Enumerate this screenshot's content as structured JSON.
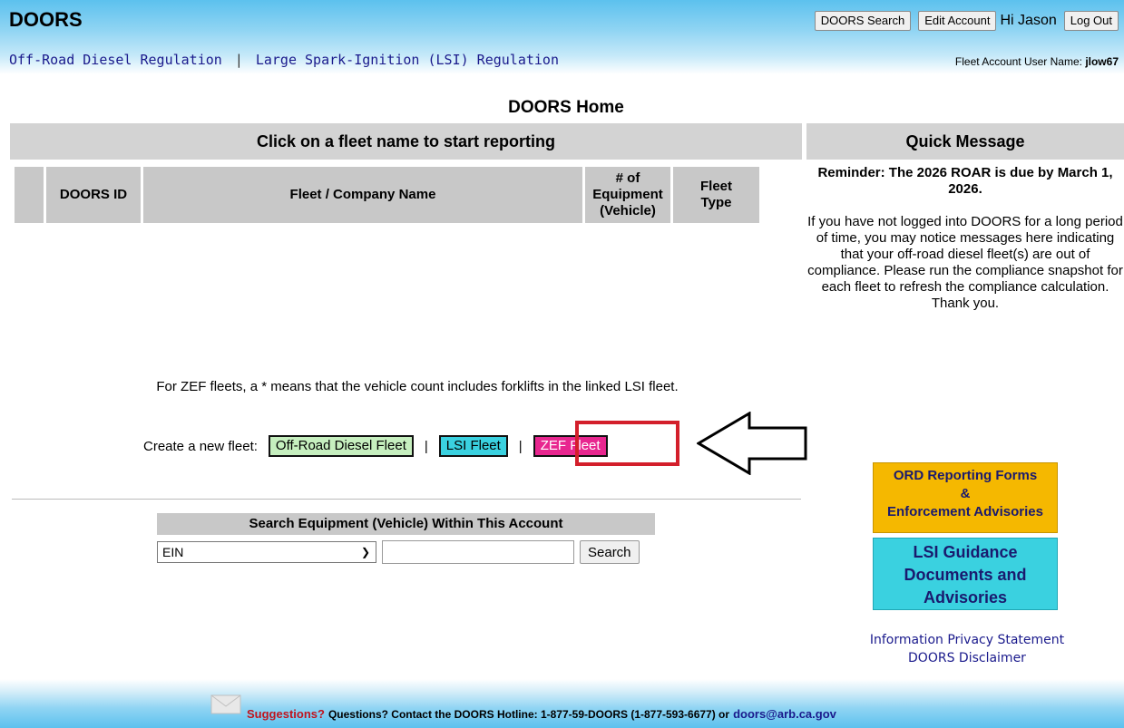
{
  "header": {
    "logo": "DOORS",
    "buttons": {
      "search": "DOORS Search",
      "edit": "Edit Account",
      "logout": "Log Out"
    },
    "greeting": "Hi Jason"
  },
  "nav": {
    "diesel": "Off-Road Diesel Regulation",
    "separator": "|",
    "lsi": "Large Spark-Ignition (LSI) Regulation"
  },
  "user": {
    "label": "Fleet Account User Name:",
    "value": "jlow67"
  },
  "page_title": "DOORS Home",
  "fleet_banner": "Click on a fleet name to start reporting",
  "quick_banner": "Quick Message",
  "table": {
    "headers": {
      "id": "DOORS ID",
      "name": "Fleet / Company Name",
      "count_l1": "# of",
      "count_l2": "Equipment",
      "count_l3": "(Vehicle)",
      "type_l1": "Fleet",
      "type_l2": "Type"
    }
  },
  "quick_message": {
    "reminder": "Reminder: The 2026 ROAR is due by March 1, 2026.",
    "body": "If you have not logged into DOORS for a long period of time, you may notice messages here indicating that your off-road diesel fleet(s) are out of compliance. Please run the compliance snapshot for each fleet to refresh the compliance calculation. Thank you."
  },
  "zef_note": "For ZEF fleets, a * means that the vehicle count includes forklifts in the linked LSI fleet.",
  "create": {
    "label": "Create a new fleet:",
    "diesel": "Off-Road Diesel Fleet",
    "lsi": "LSI Fleet",
    "zef": "ZEF Fleet",
    "sep": "|"
  },
  "search": {
    "heading": "Search Equipment (Vehicle) Within This Account",
    "selected": "EIN",
    "button": "Search"
  },
  "sidebar": {
    "ord_l1": "ORD Reporting Forms",
    "ord_l2": "&",
    "ord_l3": "Enforcement Advisories",
    "lsi_l1": "LSI Guidance",
    "lsi_l2": "Documents and",
    "lsi_l3": "Advisories",
    "privacy": "Information Privacy Statement",
    "disclaimer": "DOORS Disclaimer"
  },
  "footer": {
    "suggestions": "Suggestions?",
    "text": "Questions? Contact the DOORS Hotline: 1-877-59-DOORS (1-877-593-6677) or",
    "email": "doors@arb.ca.gov"
  },
  "colors": {
    "diesel_btn": "#c6efbf",
    "lsi_btn": "#3ad1e0",
    "zef_btn": "#e8268f",
    "highlight": "#d31f2b"
  }
}
